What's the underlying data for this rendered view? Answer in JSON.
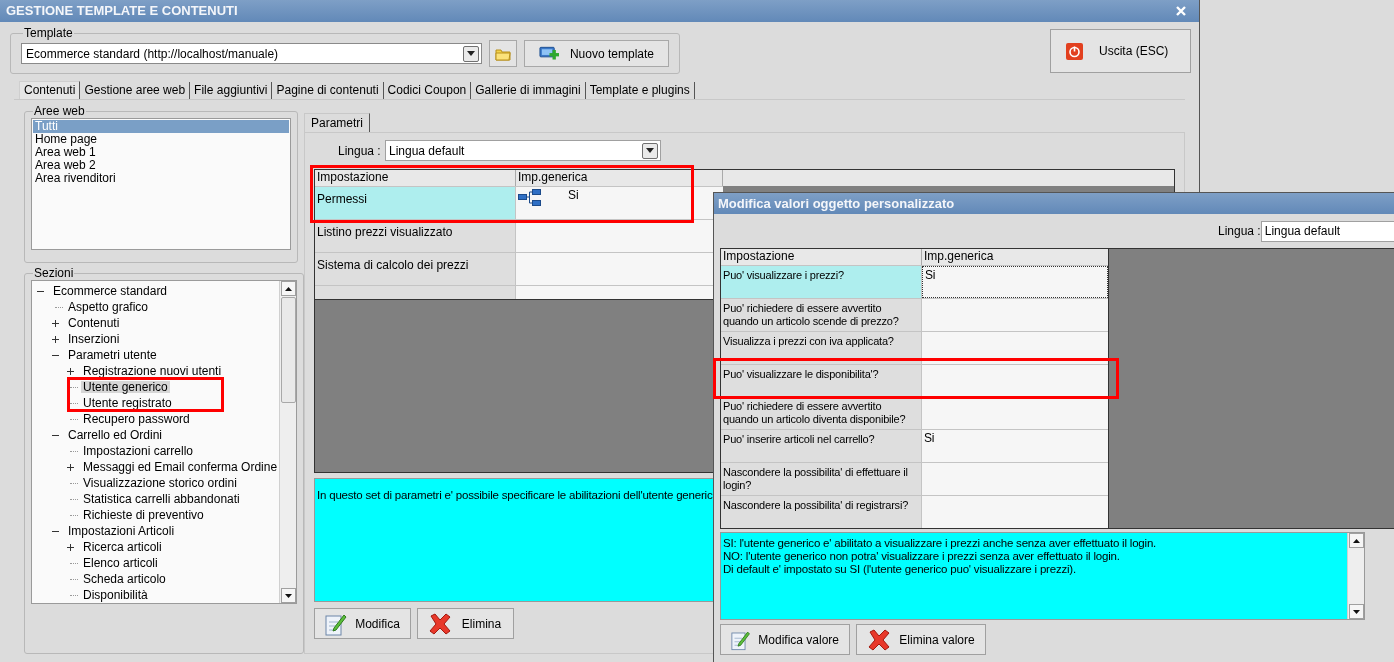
{
  "main_window": {
    "title": "GESTIONE TEMPLATE E CONTENUTI",
    "template": {
      "label": "Template",
      "value": "Ecommerce standard (http://localhost/manuale)",
      "new_button": "Nuovo template"
    },
    "exit_button": "Uscita (ESC)",
    "tabs": [
      {
        "label": "Contenuti",
        "selected": true
      },
      {
        "label": "Gestione aree web",
        "selected": false
      },
      {
        "label": "File aggiuntivi",
        "selected": false
      },
      {
        "label": "Pagine di contenuti",
        "selected": false
      },
      {
        "label": "Codici Coupon",
        "selected": false
      },
      {
        "label": "Gallerie di immagini",
        "selected": false
      },
      {
        "label": "Template e plugins",
        "selected": false
      }
    ],
    "web_areas": {
      "label": "Aree web",
      "items": [
        {
          "label": "Tutti",
          "selected": true
        },
        {
          "label": "Home page",
          "selected": false
        },
        {
          "label": "Area web 1",
          "selected": false
        },
        {
          "label": "Area web 2",
          "selected": false
        },
        {
          "label": "Area rivenditori",
          "selected": false
        }
      ]
    },
    "sections": {
      "label": "Sezioni",
      "tree": [
        {
          "label": "Ecommerce standard",
          "selected": false,
          "expanded": true,
          "children": [
            {
              "label": "Aspetto grafico",
              "selected": false
            },
            {
              "label": "Contenuti",
              "selected": false,
              "expanded": false
            },
            {
              "label": "Inserzioni",
              "selected": false,
              "expanded": false
            },
            {
              "label": "Parametri utente",
              "selected": false,
              "expanded": true,
              "children": [
                {
                  "label": "Registrazione nuovi utenti",
                  "selected": false,
                  "expanded": false
                },
                {
                  "label": "Utente generico",
                  "selected": true
                },
                {
                  "label": "Utente registrato",
                  "selected": false
                },
                {
                  "label": "Recupero password",
                  "selected": false
                }
              ]
            },
            {
              "label": "Carrello ed Ordini",
              "selected": false,
              "expanded": true,
              "children": [
                {
                  "label": "Impostazioni carrello",
                  "selected": false
                },
                {
                  "label": "Messaggi ed Email conferma Ordine",
                  "selected": false,
                  "expanded": false
                },
                {
                  "label": "Visualizzazione storico ordini",
                  "selected": false
                },
                {
                  "label": "Statistica carrelli abbandonati",
                  "selected": false
                },
                {
                  "label": "Richieste di preventivo",
                  "selected": false
                }
              ]
            },
            {
              "label": "Impostazioni Articoli",
              "selected": false,
              "expanded": true,
              "children": [
                {
                  "label": "Ricerca articoli",
                  "selected": false,
                  "expanded": false
                },
                {
                  "label": "Elenco articoli",
                  "selected": false
                },
                {
                  "label": "Scheda articolo",
                  "selected": false
                },
                {
                  "label": "Disponibilità",
                  "selected": false
                }
              ]
            }
          ]
        }
      ]
    },
    "params": {
      "tab": "Parametri",
      "language_label": "Lingua :",
      "language": "Lingua default",
      "columns": [
        "Impostazione",
        "Imp.generica"
      ],
      "rows": [
        {
          "setting": "Permessi",
          "value": "Si",
          "has_icon": true,
          "selected": true
        },
        {
          "setting": "Listino prezzi visualizzato",
          "selected": false
        },
        {
          "setting": "Sistema di calcolo dei prezzi",
          "selected": false
        }
      ],
      "description": "In questo set di parametri e' possibile specificare le abilitazioni dell'utente generic",
      "buttons": [
        {
          "kind": "edit",
          "label": "Modifica"
        },
        {
          "kind": "delete",
          "label": "Elimina"
        }
      ]
    }
  },
  "dialog": {
    "title": "Modifica valori oggetto personalizzato",
    "language_label": "Lingua :",
    "language": "Lingua default",
    "columns": [
      "Impostazione",
      "Imp.generica"
    ],
    "rows": [
      {
        "setting": "Puo' visualizzare i prezzi?",
        "value": "Si",
        "selected": true
      },
      {
        "setting": "Puo' richiedere di essere avvertito quando un articolo scende di prezzo?",
        "selected": false
      },
      {
        "setting": "Visualizza i prezzi con iva applicata?",
        "selected": false
      },
      {
        "setting": "Puo' visualizzare le disponibilita'?",
        "selected": false
      },
      {
        "setting": "Puo' richiedere di essere avvertito quando un articolo diventa disponibile?",
        "selected": false
      },
      {
        "setting": "Puo' inserire articoli nel carrello?",
        "value": "Si",
        "selected": false
      },
      {
        "setting": "Nascondere la possibilita' di effettuare il login?",
        "selected": false
      },
      {
        "setting": "Nascondere la possibilita' di registrarsi?",
        "selected": false
      }
    ],
    "description": [
      "SI: l'utente generico e' abilitato a visualizzare i prezzi anche senza aver effettuato il login.",
      "NO: l'utente generico non potra' visualizzare i prezzi senza aver effettuato il login.",
      "Di default e' impostato su SI (l'utente generico puo' visualizzare i prezzi)."
    ],
    "buttons": [
      {
        "kind": "edit",
        "label": "Modifica valore"
      },
      {
        "kind": "delete",
        "label": "Elimina valore"
      }
    ]
  }
}
